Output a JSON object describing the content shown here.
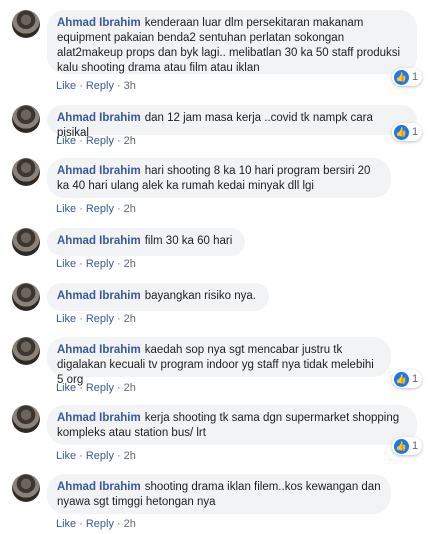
{
  "comments": [
    {
      "name": "Ahmad Ibrahim",
      "text": "kenderaan luar dlm persekitaran makanam equipment pakaian benda2 sentuhan perlatan sokongan alat2makeup props dan byk lagi.. melibatlan 30 ka 50 staff produksi kalu shooting drama atau film atau iklan",
      "like": "Like",
      "reply": "Reply",
      "time": "3h",
      "reactions": "1"
    },
    {
      "name": "Ahmad Ibrahim",
      "text": "dan 12 jam masa kerja ..covid tk nampk cara pisikal",
      "like": "Like",
      "reply": "Reply",
      "time": "2h",
      "reactions": "1"
    },
    {
      "name": "Ahmad Ibrahim",
      "text": "hari shooting 8 ka 10 hari program bersiri 20 ka 40 hari ulang alek ka rumah kedai minyak dll lgi",
      "like": "Like",
      "reply": "Reply",
      "time": "2h"
    },
    {
      "name": "Ahmad Ibrahim",
      "text": "film 30 ka 60 hari",
      "like": "Like",
      "reply": "Reply",
      "time": "2h"
    },
    {
      "name": "Ahmad Ibrahim",
      "text": "bayangkan risiko nya.",
      "like": "Like",
      "reply": "Reply",
      "time": "2h"
    },
    {
      "name": "Ahmad Ibrahim",
      "text": "kaedah sop nya sgt mencabar justru tk digalakan kecuali tv program indoor yg staff nya tidak melebihi 5 org",
      "like": "Like",
      "reply": "Reply",
      "time": "2h",
      "reactions": "1"
    },
    {
      "name": "Ahmad Ibrahim",
      "text": "kerja shooting tk sama dgn supermarket shopping kompleks atau station bus/ lrt",
      "like": "Like",
      "reply": "Reply",
      "time": "2h",
      "reactions": "1"
    },
    {
      "name": "Ahmad Ibrahim",
      "text": "shooting drama iklan filem..kos kewangan dan nyawa sgt timggi hetongan nya",
      "like": "Like",
      "reply": "Reply",
      "time": "2h"
    }
  ]
}
